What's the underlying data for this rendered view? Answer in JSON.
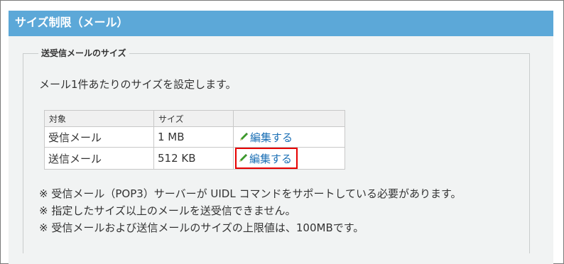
{
  "header": {
    "title": "サイズ制限（メール）"
  },
  "section": {
    "legend": "送受信メールのサイズ",
    "description": "メール1件あたりのサイズを設定します。"
  },
  "table": {
    "headers": [
      "対象",
      "サイズ",
      ""
    ],
    "rows": [
      {
        "target": "受信メール",
        "size": "1 MB",
        "action": "編集する"
      },
      {
        "target": "送信メール",
        "size": "512 KB",
        "action": "編集する"
      }
    ]
  },
  "notes": [
    "※ 受信メール（POP3）サーバーが UIDL コマンドをサポートしている必要があります。",
    "※ 指定したサイズ以上のメールを送受信できません。",
    "※ 受信メールおよび送信メールのサイズの上限値は、100MBです。"
  ],
  "colors": {
    "header_bg": "#5ca8d8",
    "panel_bg": "#f1f3f3",
    "link": "#1a6fb5",
    "highlight": "#e60000",
    "pencil": "#3a9a2a"
  },
  "icons": {
    "edit": "pencil-icon"
  }
}
